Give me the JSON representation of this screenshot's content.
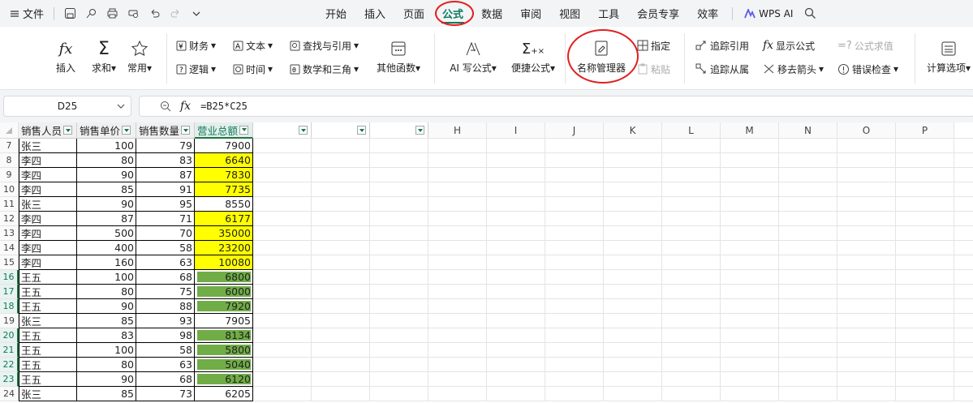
{
  "menubar": {
    "file_label": "文件",
    "quick_icons": [
      "save-icon",
      "cloud-icon",
      "print-icon",
      "print-preview-icon",
      "undo-icon",
      "redo-icon",
      "more-chevron-icon"
    ],
    "tabs": [
      "开始",
      "插入",
      "页面",
      "公式",
      "数据",
      "审阅",
      "视图",
      "工具",
      "会员专享",
      "效率"
    ],
    "active_tab": "公式",
    "wps_ai": "WPS AI"
  },
  "ribbon": {
    "insert": "插入",
    "sum": "求和",
    "common": "常用",
    "finance": "财务",
    "text": "文本",
    "lookup": "查找与引用",
    "logic": "逻辑",
    "time": "时间",
    "math": "数学和三角",
    "other": "其他函数",
    "ai_formula": "AI 写公式",
    "quick_formula": "便捷公式",
    "name_manager": "名称管理器",
    "assign": "指定",
    "paste": "粘贴",
    "trace_precedents": "追踪引用",
    "show_formula": "显示公式",
    "evaluate": "公式求值",
    "trace_dependents": "追踪从属",
    "remove_arrows": "移去箭头",
    "error_check": "错误检查",
    "calc_options": "计算选项"
  },
  "formula_bar": {
    "cell_ref": "D25",
    "fx": "fx",
    "formula": "=B25*C25"
  },
  "sheet": {
    "headers": [
      "销售人员",
      "销售单价",
      "销售数量",
      "营业总额"
    ],
    "extra_columns": [
      "H",
      "I",
      "J",
      "K",
      "L",
      "M",
      "N",
      "O",
      "P"
    ],
    "row_numbers": [
      "7",
      "8",
      "9",
      "10",
      "11",
      "12",
      "13",
      "14",
      "15",
      "16",
      "17",
      "18",
      "19",
      "20",
      "21",
      "22",
      "23",
      "24"
    ],
    "rows": [
      {
        "name": "张三",
        "price": "100",
        "qty": "79",
        "total": "7900",
        "fill": "none"
      },
      {
        "name": "李四",
        "price": "80",
        "qty": "83",
        "total": "6640",
        "fill": "yellow"
      },
      {
        "name": "李四",
        "price": "90",
        "qty": "87",
        "total": "7830",
        "fill": "yellow"
      },
      {
        "name": "李四",
        "price": "85",
        "qty": "91",
        "total": "7735",
        "fill": "yellow"
      },
      {
        "name": "张三",
        "price": "90",
        "qty": "95",
        "total": "8550",
        "fill": "none"
      },
      {
        "name": "李四",
        "price": "87",
        "qty": "71",
        "total": "6177",
        "fill": "yellow"
      },
      {
        "name": "李四",
        "price": "500",
        "qty": "70",
        "total": "35000",
        "fill": "yellow"
      },
      {
        "name": "李四",
        "price": "400",
        "qty": "58",
        "total": "23200",
        "fill": "yellow"
      },
      {
        "name": "李四",
        "price": "160",
        "qty": "63",
        "total": "10080",
        "fill": "yellow"
      },
      {
        "name": "王五",
        "price": "100",
        "qty": "68",
        "total": "6800",
        "fill": "green"
      },
      {
        "name": "王五",
        "price": "80",
        "qty": "75",
        "total": "6000",
        "fill": "green"
      },
      {
        "name": "王五",
        "price": "90",
        "qty": "88",
        "total": "7920",
        "fill": "green"
      },
      {
        "name": "张三",
        "price": "85",
        "qty": "93",
        "total": "7905",
        "fill": "none"
      },
      {
        "name": "王五",
        "price": "83",
        "qty": "98",
        "total": "8134",
        "fill": "green"
      },
      {
        "name": "王五",
        "price": "100",
        "qty": "58",
        "total": "5800",
        "fill": "green"
      },
      {
        "name": "王五",
        "price": "80",
        "qty": "63",
        "total": "5040",
        "fill": "green"
      },
      {
        "name": "王五",
        "price": "90",
        "qty": "68",
        "total": "6120",
        "fill": "green"
      },
      {
        "name": "张三",
        "price": "85",
        "qty": "73",
        "total": "6205",
        "fill": "none"
      }
    ],
    "colors": {
      "yellow": "#ffff00",
      "green": "#70ad47",
      "accent": "#0d7a5f",
      "circle": "#e02020"
    }
  }
}
